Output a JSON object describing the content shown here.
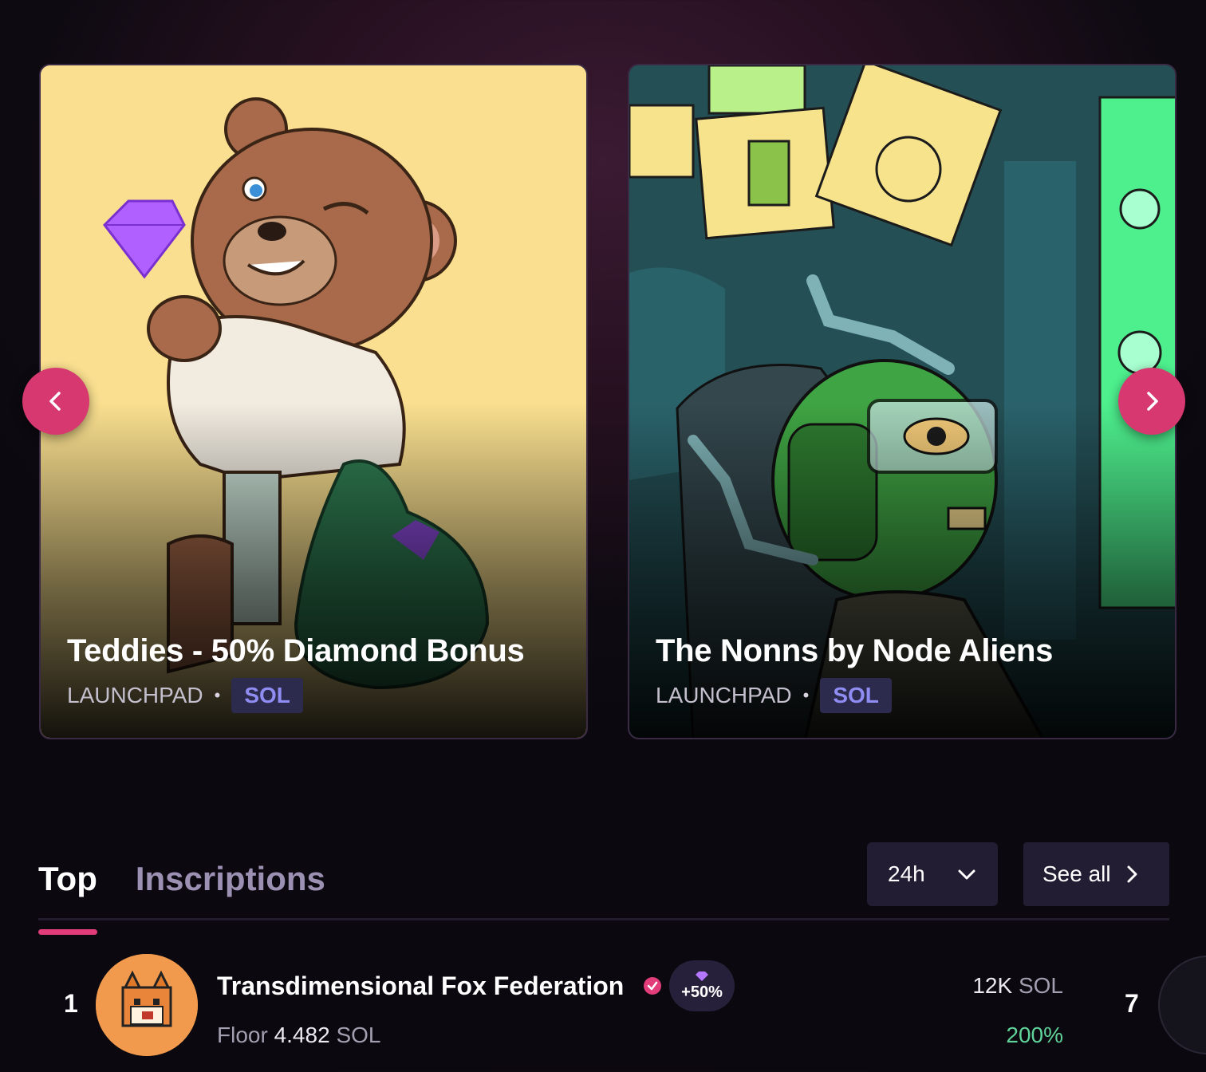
{
  "carousel": {
    "cards": [
      {
        "title": "Teddies - 50% Diamond Bonus",
        "category": "LAUNCHPAD",
        "chain": "SOL"
      },
      {
        "title": "The Nonns by Node Aliens",
        "category": "LAUNCHPAD",
        "chain": "SOL"
      }
    ],
    "separator": "•"
  },
  "tabs": {
    "top": "Top",
    "inscriptions": "Inscriptions"
  },
  "controls": {
    "period": "24h",
    "see_all": "See all"
  },
  "rows": [
    {
      "rank": "1",
      "name": "Transdimensional Fox Federation",
      "bonus": "+50%",
      "floor_label": "Floor",
      "floor_value": "4.482",
      "floor_unit": "SOL",
      "volume_value": "12K",
      "volume_unit": "SOL",
      "change": "200%"
    },
    {
      "rank": "7"
    }
  ],
  "colors": {
    "accent": "#e23d7a",
    "arrow": "#d6386f",
    "positive": "#5fd39a",
    "chain_badge": "#8f8cf2"
  },
  "icons": [
    "chevron-left-icon",
    "chevron-right-icon",
    "chevron-down-icon",
    "verified-icon",
    "diamond-icon"
  ]
}
